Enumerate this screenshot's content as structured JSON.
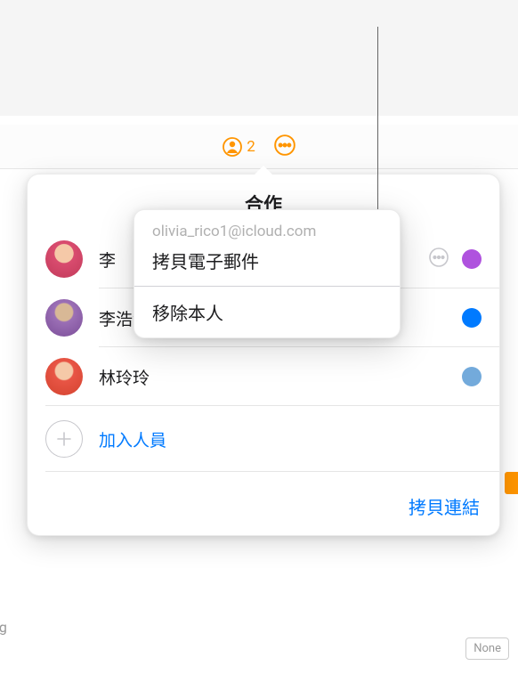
{
  "toolbar": {
    "collab_count": "2"
  },
  "popover": {
    "title": "合作",
    "participants": [
      {
        "name": "李",
        "color": "purple"
      },
      {
        "name": "李浩瀚（擁有者）",
        "color": "blue"
      },
      {
        "name": "林玲玲",
        "color": "lightblue"
      }
    ],
    "add_label": "加入人員",
    "copy_link_label": "拷貝連結"
  },
  "context_menu": {
    "email": "olivia_rico1@icloud.com",
    "copy_email_label": "拷貝電子郵件",
    "remove_label": "移除本人"
  },
  "background": {
    "left_text": "ng",
    "right_box": "None"
  }
}
